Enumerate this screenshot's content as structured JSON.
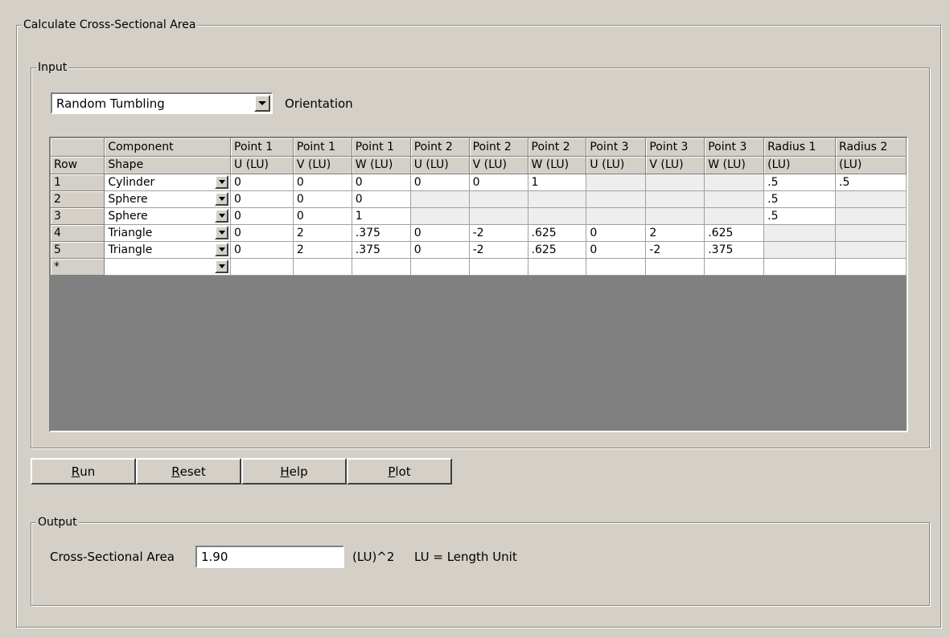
{
  "outer_group": {
    "title": "Calculate Cross-Sectional Area"
  },
  "input_group": {
    "title": "Input",
    "orientation_value": "Random Tumbling",
    "orientation_label": "Orientation"
  },
  "grid": {
    "header_top": [
      "",
      "Component",
      "Point 1",
      "Point 1",
      "Point 1",
      "Point 2",
      "Point 2",
      "Point 2",
      "Point 3",
      "Point 3",
      "Point 3",
      "Radius 1",
      "Radius 2"
    ],
    "header_bottom": [
      "Row",
      "Shape",
      "U (LU)",
      "V (LU)",
      "W (LU)",
      "U (LU)",
      "V (LU)",
      "W (LU)",
      "U (LU)",
      "V (LU)",
      "W (LU)",
      "(LU)",
      "(LU)"
    ],
    "rows": [
      {
        "row": "1",
        "shape": "Cylinder",
        "values": [
          "0",
          "0",
          "0",
          "0",
          "0",
          "1",
          "",
          "",
          "",
          ".5",
          ".5"
        ],
        "disabled": [
          false,
          false,
          false,
          false,
          false,
          false,
          true,
          true,
          true,
          false,
          false
        ]
      },
      {
        "row": "2",
        "shape": "Sphere",
        "values": [
          "0",
          "0",
          "0",
          "",
          "",
          "",
          "",
          "",
          "",
          ".5",
          ""
        ],
        "disabled": [
          false,
          false,
          false,
          true,
          true,
          true,
          true,
          true,
          true,
          false,
          true
        ]
      },
      {
        "row": "3",
        "shape": "Sphere",
        "values": [
          "0",
          "0",
          "1",
          "",
          "",
          "",
          "",
          "",
          "",
          ".5",
          ""
        ],
        "disabled": [
          false,
          false,
          false,
          true,
          true,
          true,
          true,
          true,
          true,
          false,
          true
        ]
      },
      {
        "row": "4",
        "shape": "Triangle",
        "values": [
          "0",
          "2",
          ".375",
          "0",
          "-2",
          ".625",
          "0",
          "2",
          ".625",
          "",
          ""
        ],
        "disabled": [
          false,
          false,
          false,
          false,
          false,
          false,
          false,
          false,
          false,
          true,
          true
        ]
      },
      {
        "row": "5",
        "shape": "Triangle",
        "values": [
          "0",
          "2",
          ".375",
          "0",
          "-2",
          ".625",
          "0",
          "-2",
          ".375",
          "",
          ""
        ],
        "disabled": [
          false,
          false,
          false,
          false,
          false,
          false,
          false,
          false,
          false,
          true,
          true
        ]
      },
      {
        "row": "*",
        "shape": "",
        "values": [
          "",
          "",
          "",
          "",
          "",
          "",
          "",
          "",
          "",
          "",
          ""
        ],
        "disabled": [
          false,
          false,
          false,
          false,
          false,
          false,
          false,
          false,
          false,
          false,
          false
        ]
      }
    ]
  },
  "buttons": {
    "run": {
      "pre": "",
      "key": "R",
      "post": "un"
    },
    "reset": {
      "pre": "",
      "key": "R",
      "post": "eset"
    },
    "help": {
      "pre": "",
      "key": "H",
      "post": "elp"
    },
    "plot": {
      "pre": "",
      "key": "P",
      "post": "lot"
    }
  },
  "output_group": {
    "title": "Output",
    "area_label": "Cross-Sectional Area",
    "area_value": "1.90",
    "unit": "(LU)^2",
    "unit_note": "LU = Length Unit"
  }
}
